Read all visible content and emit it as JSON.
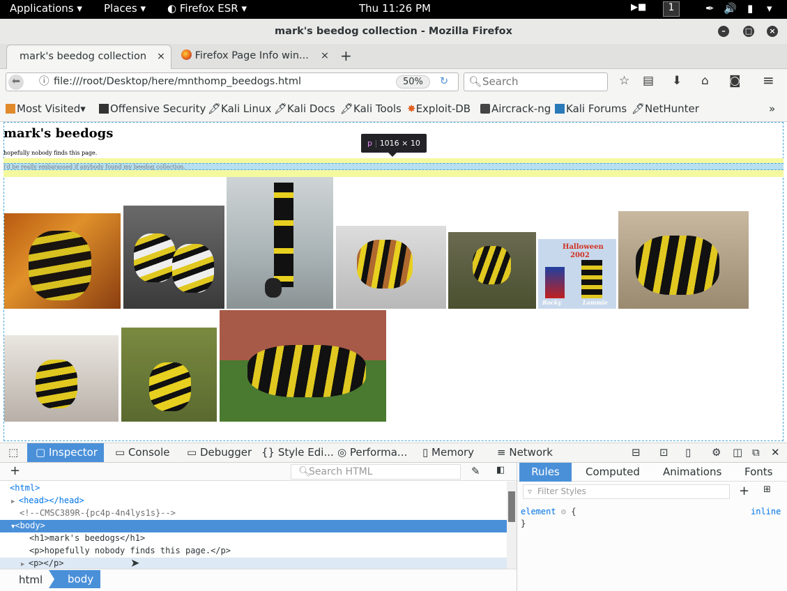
{
  "system_bar": {
    "applications": "Applications",
    "places": "Places",
    "browser": "Firefox ESR",
    "clock": "Thu 11:26 PM",
    "workspace": "1"
  },
  "window": {
    "title": "mark's beedog collection - Mozilla Firefox"
  },
  "tabs": [
    {
      "label": "mark's beedog collection"
    },
    {
      "label": "Firefox Page Info win..."
    }
  ],
  "navbar": {
    "url": "file:///root/Desktop/here/mnthomp_beedogs.html",
    "zoom": "50%",
    "search_placeholder": "Search"
  },
  "bookmarks": [
    {
      "label": "Most Visited"
    },
    {
      "label": "Offensive Security"
    },
    {
      "label": "Kali Linux"
    },
    {
      "label": "Kali Docs"
    },
    {
      "label": "Kali Tools"
    },
    {
      "label": "Exploit-DB"
    },
    {
      "label": "Aircrack-ng"
    },
    {
      "label": "Kali Forums"
    },
    {
      "label": "NetHunter"
    }
  ],
  "page": {
    "heading": "mark's beedogs",
    "para1": "hopefully nobody finds this page.",
    "para2": "i'd be really embarassed if anybody found my beedog collection.",
    "photo_caption_halloween": "Halloween",
    "photo_caption_year": "2002",
    "photo_caption_rocky": "Rocky",
    "photo_caption_lammie": "Lammie"
  },
  "tooltip": {
    "tag": "p",
    "size": "1016 × 10"
  },
  "devtools": {
    "tabs": [
      {
        "label": "Inspector"
      },
      {
        "label": "Console"
      },
      {
        "label": "Debugger"
      },
      {
        "label": "Style Edi..."
      },
      {
        "label": "Performa..."
      },
      {
        "label": "Memory"
      },
      {
        "label": "Network"
      }
    ],
    "search_html_placeholder": "Search HTML",
    "markup": [
      "<html>",
      "<head></head>",
      "<!--CMSC389R-{pc4p-4n4lys1s}-->",
      "<body>",
      "<h1>mark's beedogs</h1>",
      "<p>hopefully nobody finds this page.</p>",
      "<p></p>"
    ],
    "breadcrumb": [
      "html",
      "body"
    ],
    "side_tabs": [
      {
        "label": "Rules"
      },
      {
        "label": "Computed"
      },
      {
        "label": "Animations"
      },
      {
        "label": "Fonts"
      }
    ],
    "filter_placeholder": "Filter Styles",
    "rule_selector": "element",
    "rule_open": "{",
    "rule_close": "}",
    "rule_source": "inline"
  },
  "colors": {
    "accent": "#4a90d9",
    "highlight_yellow": "#f4f9a0",
    "highlight_blue": "#b8dff0",
    "tag": "#0074e8"
  }
}
